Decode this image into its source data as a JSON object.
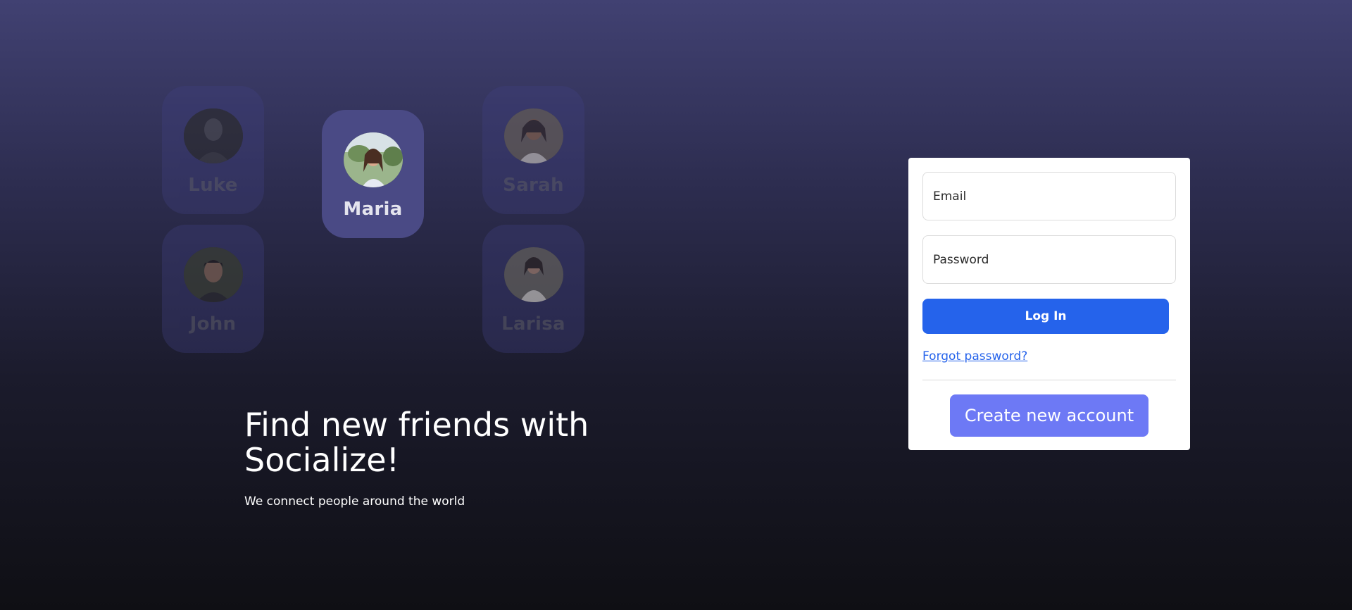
{
  "profiles": {
    "luke": {
      "name": "Luke"
    },
    "maria": {
      "name": "Maria"
    },
    "sarah": {
      "name": "Sarah"
    },
    "john": {
      "name": "John"
    },
    "larisa": {
      "name": "Larisa"
    }
  },
  "hero": {
    "title": "Find new friends with Socialize!",
    "subtitle": "We connect people around the world"
  },
  "login": {
    "email_placeholder": "Email",
    "password_placeholder": "Password",
    "login_label": "Log In",
    "forgot_label": "Forgot password?",
    "create_label": "Create new account"
  },
  "colors": {
    "primary": "#2563eb",
    "secondary": "#6d79f5",
    "background_top": "#414172",
    "background_bottom": "#0f0f14"
  }
}
